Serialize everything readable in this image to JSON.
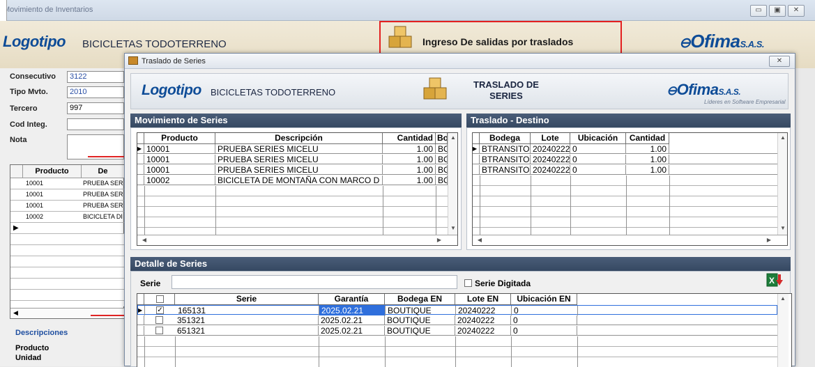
{
  "background_window": {
    "title": "Movimiento de Inventarios",
    "logo": "Logotipo",
    "company": "BICICLETAS TODOTERRENO",
    "screen_title": "Ingreso De salidas por traslados",
    "brand": "Ofima",
    "brand_suffix": "S.A.S.",
    "fields": [
      {
        "label": "Consecutivo",
        "value": "3122"
      },
      {
        "label": "Tipo Mvto.",
        "value": "2010"
      },
      {
        "label": "Tercero",
        "value": "997"
      },
      {
        "label": "Cod Integ.",
        "value": ""
      },
      {
        "label": "Nota",
        "value": ""
      }
    ],
    "grid_headers": [
      "Producto",
      "De"
    ],
    "grid_rows": [
      {
        "producto": "10001",
        "desc": "PRUEBA SER"
      },
      {
        "producto": "10001",
        "desc": "PRUEBA SER"
      },
      {
        "producto": "10001",
        "desc": "PRUEBA SER"
      },
      {
        "producto": "10002",
        "desc": "BICICLETA DI"
      }
    ],
    "descripciones_title": "Descripciones",
    "descripciones_items": [
      "Producto",
      "Unidad"
    ],
    "accent_color": "#e32020"
  },
  "dialog": {
    "title": "Traslado de Series",
    "logo": "Logotipo",
    "company": "BICICLETAS TODOTERRENO",
    "header_title_line1": "TRASLADO DE",
    "header_title_line2": "SERIES",
    "brand": "Ofima",
    "brand_suffix": "S.A.S.",
    "brand_tagline": "Líderes en Software Empresarial",
    "movimiento": {
      "section_title": "Movimiento de Series",
      "headers": [
        "Producto",
        "Descripción",
        "Cantidad",
        "Bo"
      ],
      "rows": [
        {
          "producto": "10001",
          "descripcion": "PRUEBA SERIES MICELU",
          "cantidad": "1.00",
          "bodega": "BC"
        },
        {
          "producto": "10001",
          "descripcion": "PRUEBA SERIES MICELU",
          "cantidad": "1.00",
          "bodega": "BC"
        },
        {
          "producto": "10001",
          "descripcion": "PRUEBA SERIES MICELU",
          "cantidad": "1.00",
          "bodega": "BC"
        },
        {
          "producto": "10002",
          "descripcion": "BICICLETA DE MONTAÑA CON MARCO D",
          "cantidad": "1.00",
          "bodega": "BC"
        }
      ]
    },
    "traslado": {
      "section_title": "Traslado - Destino",
      "headers": [
        "Bodega",
        "Lote",
        "Ubicación",
        "Cantidad"
      ],
      "rows": [
        {
          "bodega": "BTRANSITO",
          "lote": "20240222",
          "ubicacion": "0",
          "cantidad": "1.00"
        },
        {
          "bodega": "BTRANSITO",
          "lote": "20240222",
          "ubicacion": "0",
          "cantidad": "1.00"
        },
        {
          "bodega": "BTRANSITO",
          "lote": "20240222",
          "ubicacion": "0",
          "cantidad": "1.00"
        }
      ]
    },
    "detalle": {
      "section_title": "Detalle de Series",
      "serie_label": "Serie",
      "serie_value": "",
      "serie_digitada_label": "Serie Digitada",
      "headers": [
        "Serie",
        "Garantía",
        "Bodega EN",
        "Lote EN",
        "Ubicación EN"
      ],
      "rows": [
        {
          "checked": "✓",
          "serie": "165131",
          "garantia": "2025.02.21",
          "bodega": "BOUTIQUE",
          "lote": "20240222",
          "ubicacion": "0"
        },
        {
          "checked": "",
          "serie": "351321",
          "garantia": "2025.02.21",
          "bodega": "BOUTIQUE",
          "lote": "20240222",
          "ubicacion": "0"
        },
        {
          "checked": "",
          "serie": "651321",
          "garantia": "2025.02.21",
          "bodega": "BOUTIQUE",
          "lote": "20240222",
          "ubicacion": "0"
        }
      ],
      "selection_color": "#2f6fdc"
    }
  }
}
